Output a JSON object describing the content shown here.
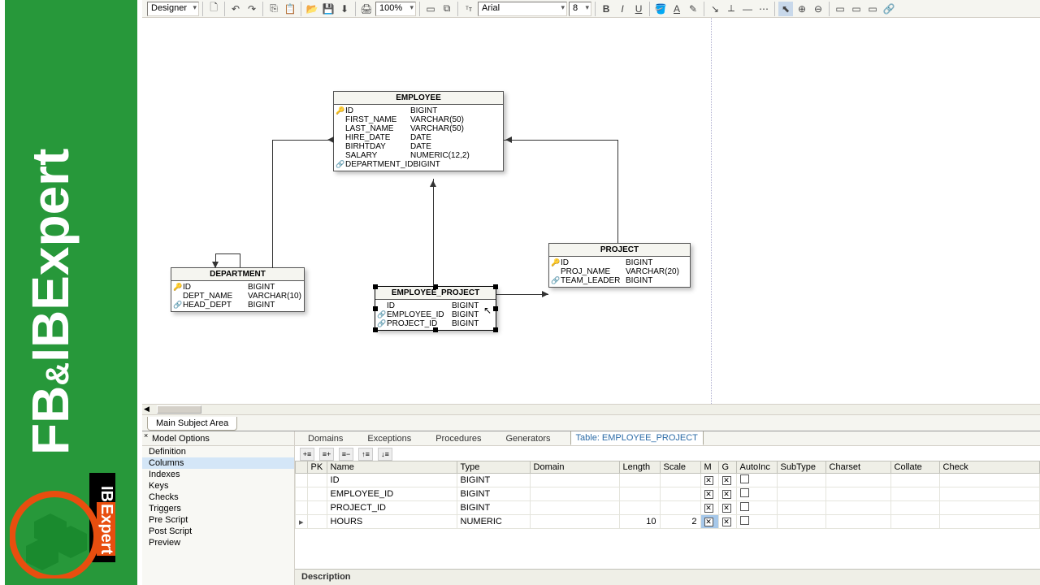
{
  "brand": {
    "line1": "FB",
    "amp": "&",
    "line2": "IBExpert",
    "badge1": "IB",
    "badge2": "Expert"
  },
  "toolbar": {
    "designer": "Designer",
    "zoom": "100%",
    "font": "Arial",
    "fontsize": "8"
  },
  "entities": {
    "employee": {
      "title": "EMPLOYEE",
      "rows": [
        {
          "k": "🔑",
          "n": "ID",
          "t": "BIGINT"
        },
        {
          "k": "",
          "n": "FIRST_NAME",
          "t": "VARCHAR(50)"
        },
        {
          "k": "",
          "n": "LAST_NAME",
          "t": "VARCHAR(50)"
        },
        {
          "k": "",
          "n": "HIRE_DATE",
          "t": "DATE"
        },
        {
          "k": "",
          "n": "BIRHTDAY",
          "t": "DATE"
        },
        {
          "k": "",
          "n": "SALARY",
          "t": "NUMERIC(12,2)"
        },
        {
          "k": "🔗",
          "n": "DEPARTMENT_ID",
          "t": "BIGINT"
        }
      ]
    },
    "department": {
      "title": "DEPARTMENT",
      "rows": [
        {
          "k": "🔑",
          "n": "ID",
          "t": "BIGINT"
        },
        {
          "k": "",
          "n": "DEPT_NAME",
          "t": "VARCHAR(10)"
        },
        {
          "k": "🔗",
          "n": "HEAD_DEPT",
          "t": "BIGINT"
        }
      ]
    },
    "employee_project": {
      "title": "EMPLOYEE_PROJECT",
      "rows": [
        {
          "k": "",
          "n": "ID",
          "t": "BIGINT"
        },
        {
          "k": "🔗",
          "n": "EMPLOYEE_ID",
          "t": "BIGINT"
        },
        {
          "k": "🔗",
          "n": "PROJECT_ID",
          "t": "BIGINT"
        }
      ]
    },
    "project": {
      "title": "PROJECT",
      "rows": [
        {
          "k": "🔑",
          "n": "ID",
          "t": "BIGINT"
        },
        {
          "k": "",
          "n": "PROJ_NAME",
          "t": "VARCHAR(20)"
        },
        {
          "k": "🔗",
          "n": "TEAM_LEADER",
          "t": "BIGINT"
        }
      ]
    }
  },
  "subject_tab": "Main Subject Area",
  "panel": {
    "tabs": [
      "Model Options",
      "Domains",
      "Exceptions",
      "Procedures",
      "Generators"
    ],
    "active_tab": "Table: EMPLOYEE_PROJECT",
    "side": [
      "Definition",
      "Columns",
      "Indexes",
      "Keys",
      "Checks",
      "Triggers",
      "Pre Script",
      "Post Script",
      "Preview"
    ],
    "side_sel": "Columns",
    "grid_headers": [
      "",
      "PK",
      "Name",
      "Type",
      "Domain",
      "Length",
      "Scale",
      "M",
      "G",
      "AutoInc",
      "SubType",
      "Charset",
      "Collate",
      "Check"
    ],
    "grid_rows": [
      {
        "ind": "",
        "pk": "",
        "name": "ID",
        "type": "BIGINT",
        "domain": "",
        "len": "",
        "scale": "",
        "m": true,
        "g": true,
        "auto": false
      },
      {
        "ind": "",
        "pk": "",
        "name": "EMPLOYEE_ID",
        "type": "BIGINT",
        "domain": "",
        "len": "",
        "scale": "",
        "m": true,
        "g": true,
        "auto": false
      },
      {
        "ind": "",
        "pk": "",
        "name": "PROJECT_ID",
        "type": "BIGINT",
        "domain": "",
        "len": "",
        "scale": "",
        "m": true,
        "g": true,
        "auto": false
      },
      {
        "ind": "▸",
        "pk": "",
        "name": "HOURS",
        "type": "NUMERIC",
        "domain": "",
        "len": "10",
        "scale": "2",
        "m": true,
        "g": true,
        "auto": false,
        "msel": true
      }
    ],
    "desc": "Description"
  }
}
